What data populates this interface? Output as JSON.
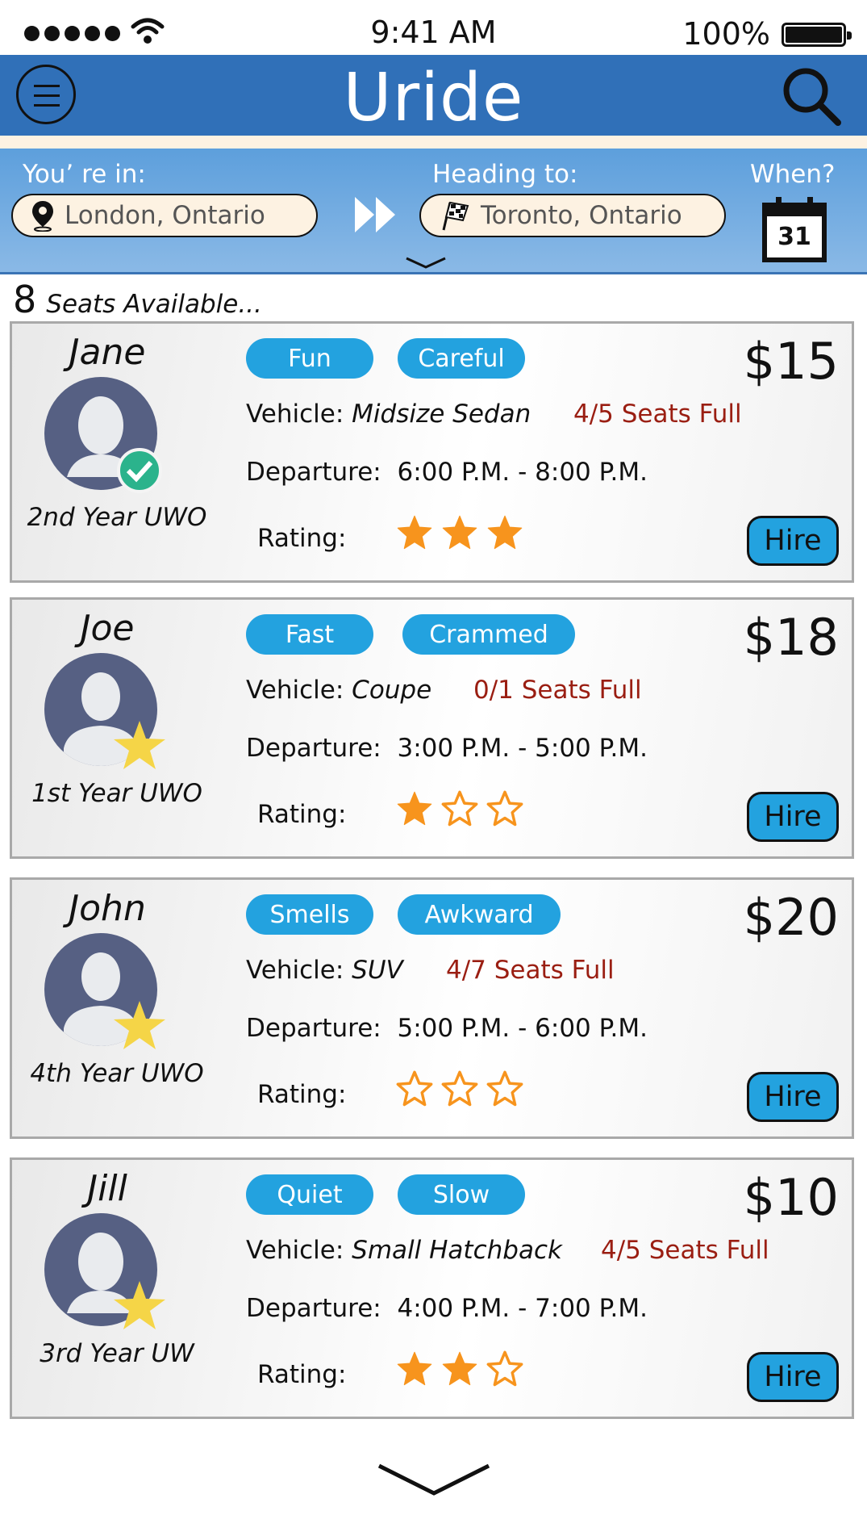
{
  "status_bar": {
    "time": "9:41 AM",
    "battery": "100%"
  },
  "app": {
    "title": "Uride"
  },
  "trip": {
    "from_label": "You’ re in:",
    "from_value": "London, Ontario",
    "to_label": "Heading to:",
    "to_value": "Toronto, Ontario",
    "when_label": "When?",
    "calendar_day": "31"
  },
  "seats": {
    "count": "8",
    "label": "Seats Available..."
  },
  "labels": {
    "vehicle": "Vehicle:",
    "departure": "Departure:",
    "rating": "Rating:",
    "hire": "Hire"
  },
  "colors": {
    "header": "#3070b8",
    "tag": "#23a2df",
    "star": "#f7941d",
    "badge_star": "#f5d547",
    "seats_full": "#9a1e12",
    "avatar": "#566083"
  },
  "drivers": [
    {
      "name": "Jane",
      "year": "2nd Year UWO",
      "gender": "female",
      "badge": "verified-check",
      "tags": [
        "Fun",
        "Careful"
      ],
      "price": "$15",
      "vehicle": "Midsize Sedan",
      "seats_full": "4/5 Seats Full",
      "departure": "6:00 P.M. - 8:00 P.M.",
      "rating": 3
    },
    {
      "name": "Joe",
      "year": "1st Year UWO",
      "gender": "male",
      "badge": "star",
      "tags": [
        "Fast",
        "Crammed"
      ],
      "price": "$18",
      "vehicle": "Coupe",
      "seats_full": "0/1 Seats Full",
      "departure": "3:00 P.M. - 5:00 P.M.",
      "rating": 1
    },
    {
      "name": "John",
      "year": "4th Year UWO",
      "gender": "male",
      "badge": "star",
      "tags": [
        "Smells",
        "Awkward"
      ],
      "price": "$20",
      "vehicle": "SUV",
      "seats_full": "4/7 Seats Full",
      "departure": "5:00 P.M. - 6:00 P.M.",
      "rating": 0
    },
    {
      "name": "Jill",
      "year": "3rd Year UW",
      "gender": "female",
      "badge": "star",
      "tags": [
        "Quiet",
        "Slow"
      ],
      "price": "$10",
      "vehicle": "Small Hatchback",
      "seats_full": "4/5 Seats Full",
      "departure": "4:00 P.M. - 7:00 P.M.",
      "rating": 2
    }
  ]
}
